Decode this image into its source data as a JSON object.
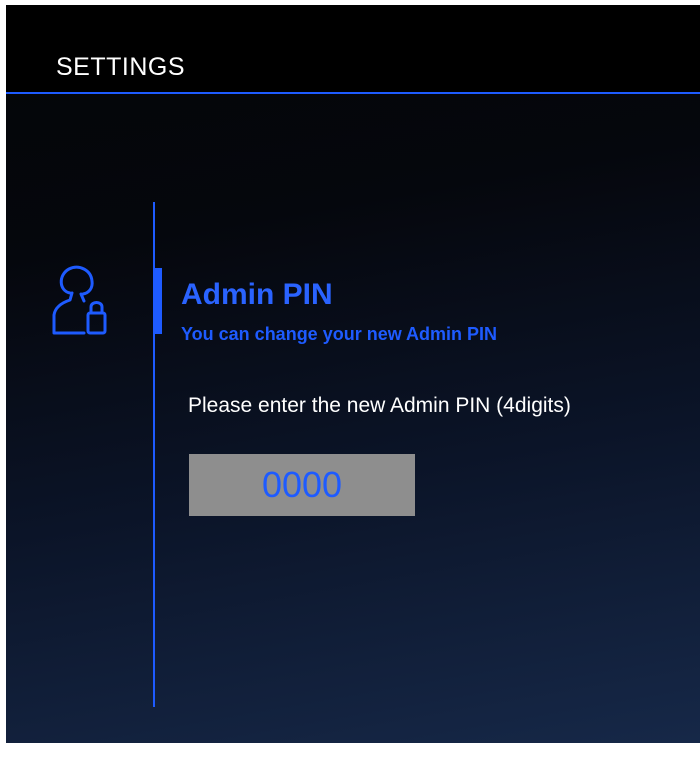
{
  "header": {
    "title": "SETTINGS"
  },
  "section": {
    "icon": "admin-lock-icon",
    "title": "Admin PIN",
    "subtitle": "You can change your new Admin PIN"
  },
  "pin_entry": {
    "prompt": "Please enter the new Admin PIN (4digits)",
    "value": "0000"
  },
  "colors": {
    "accent": "#1e5bff",
    "header_background": "#000000",
    "input_background": "#8e8e8e",
    "text": "#ffffff"
  }
}
